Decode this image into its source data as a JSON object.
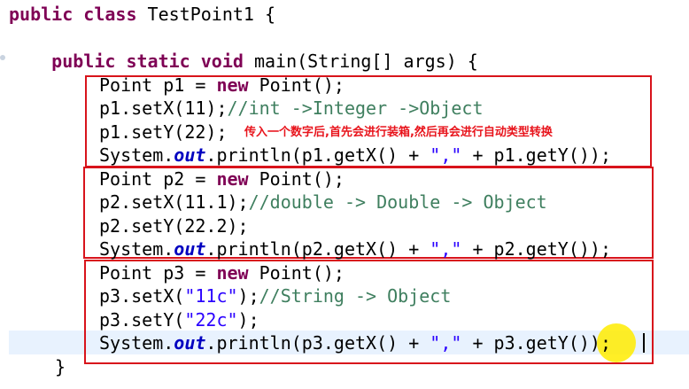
{
  "annotation": "传入一个数字后,首先会进行装箱,然后再会进行自动类型转换",
  "colors": {
    "keyword": "#7f0055",
    "comment": "#3f7f5f",
    "string": "#2a00ff",
    "field": "#0000c0",
    "box_border": "#d8131b",
    "annotation": "#e8141c",
    "highlight": "#ffec00"
  },
  "code": {
    "l1": {
      "kw1": "public",
      "sp1": " ",
      "kw2": "class",
      "rest": " TestPoint1 {"
    },
    "l2": {
      "indent": "    ",
      "kw1": "public",
      "sp1": " ",
      "kw2": "static",
      "sp2": " ",
      "kw3": "void",
      "rest": " main(String[] args) {"
    },
    "l3": {
      "a": "Point p1 = ",
      "kw": "new",
      "b": " Point();"
    },
    "l4": {
      "a": "p1.setX(11);",
      "cm": "//int ->Integer ->Object"
    },
    "l5": {
      "a": "p1.setY(22);"
    },
    "l6": {
      "a": "System.",
      "fld": "out",
      "b": ".println(p1.getX() + ",
      "str": "\",\"",
      "c": " + p1.getY());"
    },
    "l7": {
      "a": "Point p2 = ",
      "kw": "new",
      "b": " Point();"
    },
    "l8": {
      "a": "p2.setX(11.1);",
      "cm": "//double -> Double -> Object"
    },
    "l9": {
      "a": "p2.setY(22.2);"
    },
    "l10": {
      "a": "System.",
      "fld": "out",
      "b": ".println(p2.getX() + ",
      "str": "\",\"",
      "c": " + p2.getY());"
    },
    "l11": {
      "a": "Point p3 = ",
      "kw": "new",
      "b": " Point();"
    },
    "l12": {
      "a": "p3.setX(",
      "str": "\"11c\"",
      "b": ");",
      "cm": "//String -> Object"
    },
    "l13": {
      "a": "p3.setY(",
      "str": "\"22c\"",
      "b": ");"
    },
    "l14": {
      "a": "System.",
      "fld": "out",
      "b": ".println(p3.getX() + ",
      "str": "\",\"",
      "c": " + p3.getY());"
    },
    "l15": {
      "a": "}"
    }
  }
}
